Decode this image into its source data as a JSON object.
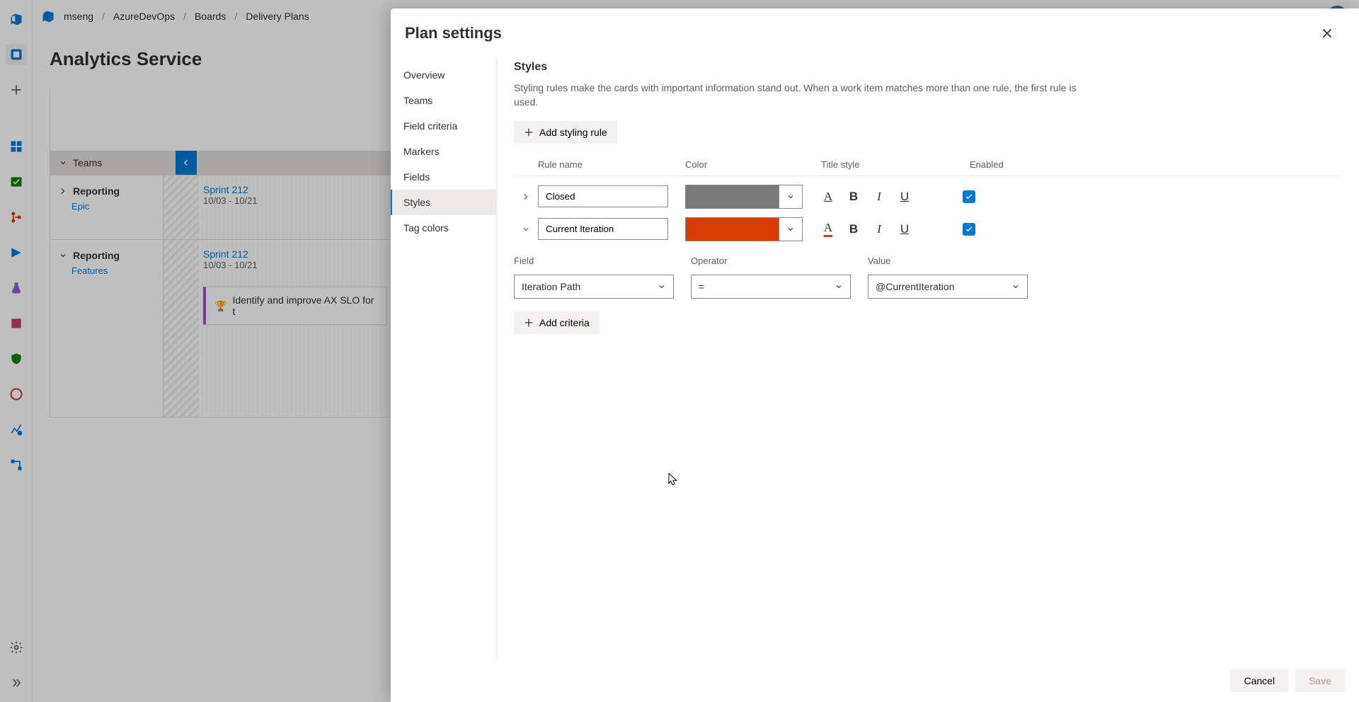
{
  "breadcrumb": {
    "items": [
      "mseng",
      "AzureDevOps",
      "Boards",
      "Delivery Plans"
    ]
  },
  "pageTitle": "Analytics Service",
  "teamsLabel": "Teams",
  "teams": [
    {
      "name": "Reporting",
      "type": "Epic",
      "sprint": {
        "name": "Sprint 212",
        "dates": "10/03 - 10/21"
      }
    },
    {
      "name": "Reporting",
      "type": "Features",
      "sprint": {
        "name": "Sprint 212",
        "dates": "10/03 - 10/21"
      },
      "cardTitle": "Identify and improve AX SLO for t"
    }
  ],
  "panel": {
    "title": "Plan settings",
    "nav": [
      "Overview",
      "Teams",
      "Field criteria",
      "Markers",
      "Fields",
      "Styles",
      "Tag colors"
    ],
    "navSelected": "Styles",
    "section": {
      "heading": "Styles",
      "description": "Styling rules make the cards with important information stand out. When a work item matches more than one rule, the first rule is used.",
      "addRuleLabel": "Add styling rule",
      "columns": {
        "name": "Rule name",
        "color": "Color",
        "title": "Title style",
        "enabled": "Enabled"
      },
      "rules": [
        {
          "expanded": false,
          "name": "Closed",
          "color": "#7a7a7a",
          "bold": true,
          "enabled": true,
          "colorUnderline": false
        },
        {
          "expanded": true,
          "name": "Current Iteration",
          "color": "#da3b01",
          "bold": true,
          "enabled": true,
          "colorUnderline": true
        }
      ],
      "criteriaLabels": {
        "field": "Field",
        "operator": "Operator",
        "value": "Value"
      },
      "criteria": {
        "field": "Iteration Path",
        "operator": "=",
        "value": "@CurrentIteration"
      },
      "addCriteriaLabel": "Add criteria"
    },
    "footer": {
      "cancel": "Cancel",
      "save": "Save"
    }
  },
  "railIcons": [
    "azure-devops-icon",
    "home-icon",
    "plus-icon",
    "dashboard-icon",
    "board-icon",
    "repo-icon",
    "pipeline-icon",
    "testplan-icon",
    "artifact-icon",
    "shield-icon",
    "circle-icon",
    "chart-icon",
    "flow-icon"
  ],
  "railBottomIcons": [
    "gear-icon",
    "expand-icon"
  ]
}
